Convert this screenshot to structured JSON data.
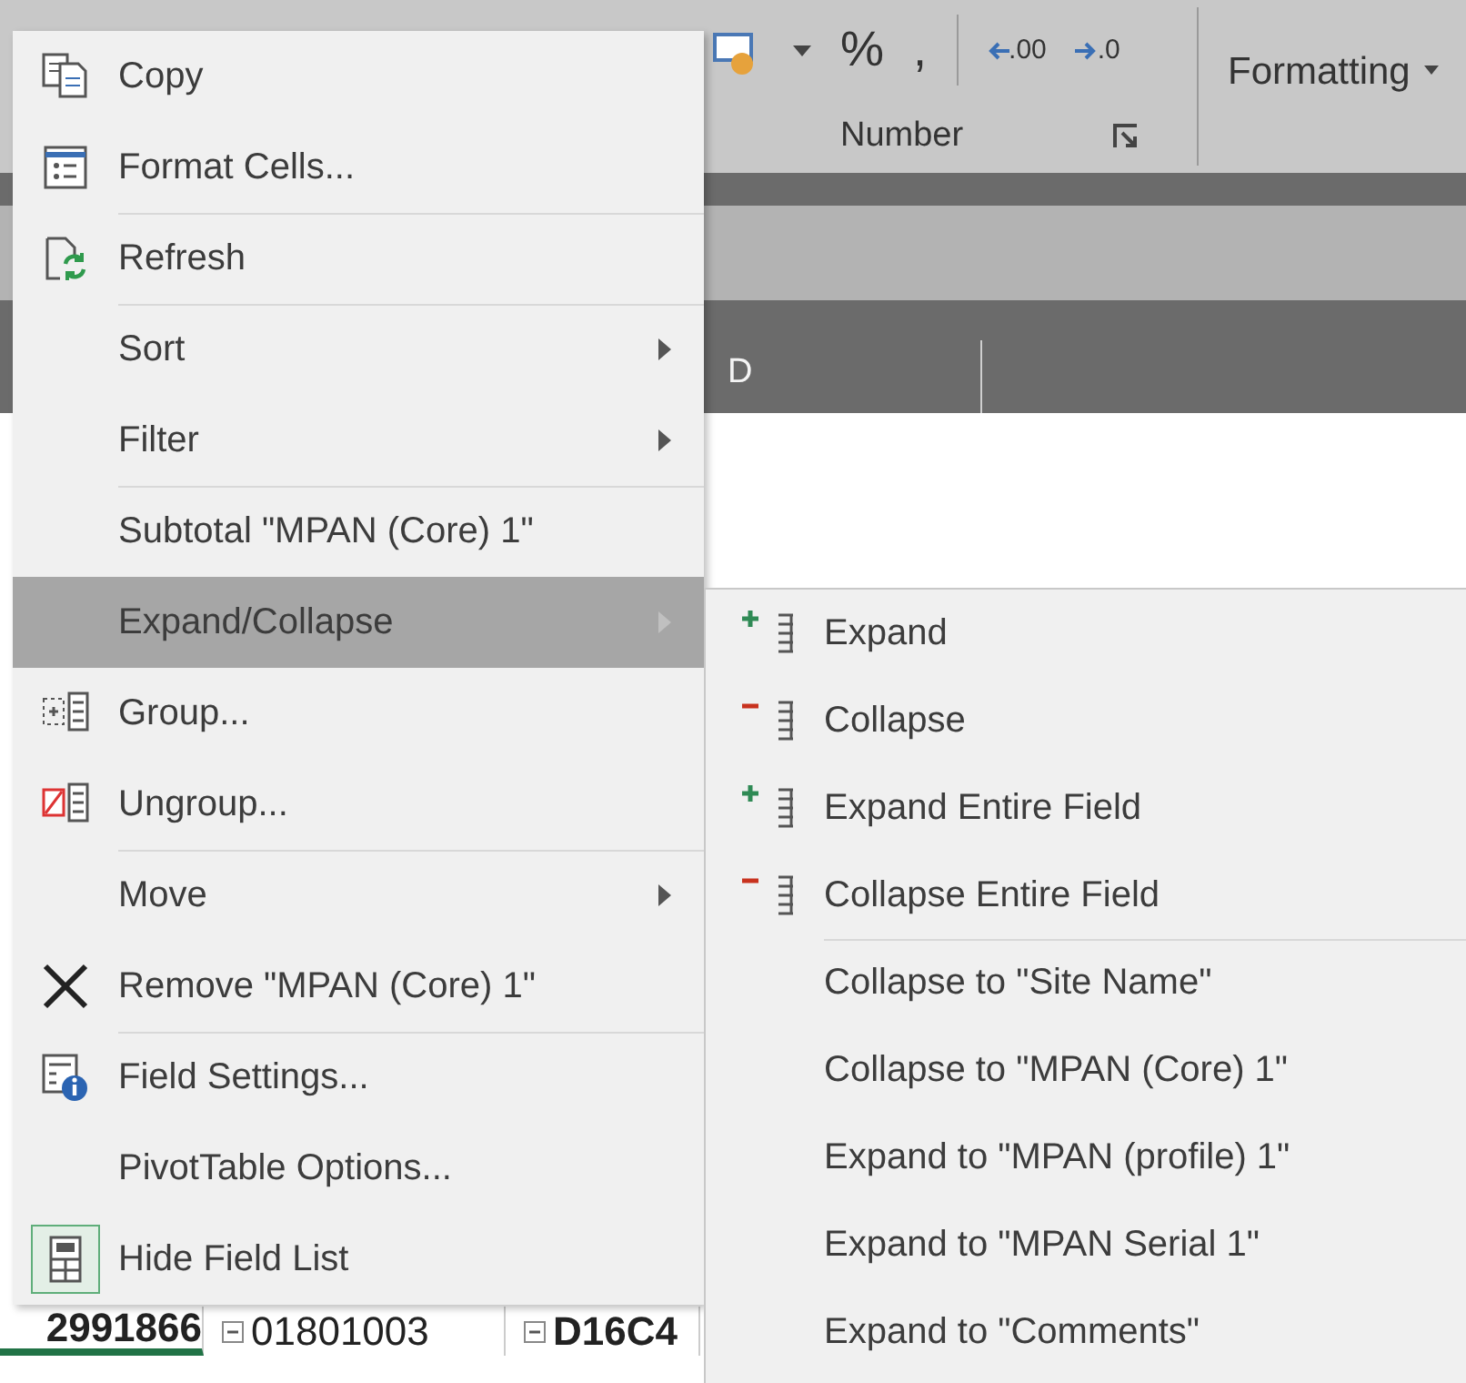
{
  "ribbon": {
    "number_buttons": [
      "%",
      ","
    ],
    "decimal_buttons": [
      ".00",
      ".0"
    ],
    "group_label": "Number",
    "conditional_formatting": "Formatting"
  },
  "sheet": {
    "column_header": "D",
    "cells": [
      {
        "text": "2991866",
        "collapse_button": false,
        "selected": true
      },
      {
        "text": "01801003",
        "collapse_button": true,
        "selected": false
      },
      {
        "text": "D16C4",
        "collapse_button": true,
        "selected": false
      }
    ]
  },
  "context_menu": {
    "items": [
      {
        "label": "Copy",
        "submenu": false,
        "highlighted": false,
        "divider_above": false,
        "checked": false
      },
      {
        "label": "Format Cells...",
        "submenu": false,
        "highlighted": false,
        "divider_above": false,
        "checked": false
      },
      {
        "label": "Refresh",
        "submenu": false,
        "highlighted": false,
        "divider_above": true,
        "checked": false
      },
      {
        "label": "Sort",
        "submenu": true,
        "highlighted": false,
        "divider_above": true,
        "checked": false
      },
      {
        "label": "Filter",
        "submenu": true,
        "highlighted": false,
        "divider_above": false,
        "checked": false
      },
      {
        "label": "Subtotal \"MPAN (Core) 1\"",
        "submenu": false,
        "highlighted": false,
        "divider_above": true,
        "checked": false
      },
      {
        "label": "Expand/Collapse",
        "submenu": true,
        "highlighted": true,
        "divider_above": false,
        "checked": false
      },
      {
        "label": "Group...",
        "submenu": false,
        "highlighted": false,
        "divider_above": false,
        "checked": false
      },
      {
        "label": "Ungroup...",
        "submenu": false,
        "highlighted": false,
        "divider_above": false,
        "checked": false
      },
      {
        "label": "Move",
        "submenu": true,
        "highlighted": false,
        "divider_above": true,
        "checked": false
      },
      {
        "label": "Remove \"MPAN (Core) 1\"",
        "submenu": false,
        "highlighted": false,
        "divider_above": false,
        "checked": false
      },
      {
        "label": "Field Settings...",
        "submenu": false,
        "highlighted": false,
        "divider_above": true,
        "checked": false
      },
      {
        "label": "PivotTable Options...",
        "submenu": false,
        "highlighted": false,
        "divider_above": false,
        "checked": false
      },
      {
        "label": "Hide Field List",
        "submenu": false,
        "highlighted": false,
        "divider_above": false,
        "checked": true
      }
    ]
  },
  "submenu": {
    "items": [
      {
        "label": "Expand",
        "divider_above": false
      },
      {
        "label": "Collapse",
        "divider_above": false
      },
      {
        "label": "Expand Entire Field",
        "divider_above": false
      },
      {
        "label": "Collapse Entire Field",
        "divider_above": false
      },
      {
        "label": "Collapse to \"Site Name\"",
        "divider_above": true
      },
      {
        "label": "Collapse to \"MPAN (Core) 1\"",
        "divider_above": false
      },
      {
        "label": "Expand to \"MPAN (profile) 1\"",
        "divider_above": false
      },
      {
        "label": "Expand to \"MPAN Serial 1\"",
        "divider_above": false
      },
      {
        "label": "Expand to \"Comments\"",
        "divider_above": false
      }
    ]
  }
}
